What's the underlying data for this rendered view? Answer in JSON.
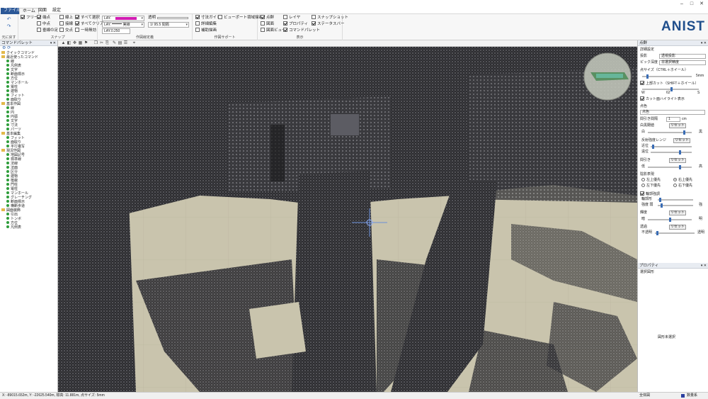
{
  "ribbon": {
    "tabs": [
      "ファイル",
      "ホーム",
      "図面",
      "設定"
    ],
    "undo_label": "元に戻す",
    "snap": {
      "label": "スナップ",
      "items": [
        {
          "label": "フリー",
          "checked": true
        },
        {
          "label": "端点",
          "checked": true
        },
        {
          "label": "中点",
          "checked": false
        },
        {
          "label": "垂線の足",
          "checked": false
        },
        {
          "label": "線上",
          "checked": false
        },
        {
          "label": "接線",
          "checked": false
        },
        {
          "label": "交点",
          "checked": false
        },
        {
          "label": "すべて選択",
          "checked": true
        },
        {
          "label": "すべてクリア",
          "checked": true
        },
        {
          "label": "一時無効",
          "checked": false
        }
      ]
    },
    "drawing_settings": {
      "label": "作図線定義",
      "layer1": "LAY.",
      "layer2": "LAY.",
      "layer2_style": "実線",
      "layer3": "LAY.0.250",
      "transparency_label": "透明",
      "scale_value": "1/ 95.5",
      "scale_suffix": "間隔"
    },
    "support": {
      "label": "作図サポート",
      "items": [
        {
          "label": "寸法ガイド",
          "checked": true
        },
        {
          "label": "ビューポート領域描画",
          "checked": false
        },
        {
          "label": "詳細編集",
          "checked": false
        },
        {
          "label": "補助描画",
          "checked": false
        }
      ]
    },
    "display": {
      "label": "表示",
      "items": [
        {
          "label": "点群",
          "checked": true
        },
        {
          "label": "図面",
          "checked": false
        },
        {
          "label": "図面ビュー",
          "checked": false
        },
        {
          "label": "レイヤ",
          "checked": false
        },
        {
          "label": "プロパティ",
          "checked": true
        },
        {
          "label": "コマンドパレット",
          "checked": true
        },
        {
          "label": "スナップショット",
          "checked": false
        },
        {
          "label": "ステータスバー",
          "checked": true
        }
      ]
    },
    "logo": "ANIST"
  },
  "command_palette": {
    "title": "コマンドパレット",
    "items": [
      {
        "label": "クイックコマンド",
        "type": "folder"
      },
      {
        "label": "最近使ったコマンド",
        "type": "folder"
      },
      {
        "label": "線",
        "type": "item"
      },
      {
        "label": "凡例表",
        "type": "item"
      },
      {
        "label": "文字",
        "type": "item"
      },
      {
        "label": "断面標示",
        "type": "item"
      },
      {
        "label": "方位",
        "type": "item"
      },
      {
        "label": "マンホール",
        "type": "item"
      },
      {
        "label": "電柱",
        "type": "item"
      },
      {
        "label": "建物",
        "type": "item"
      },
      {
        "label": "フィット",
        "type": "item"
      },
      {
        "label": "面取り",
        "type": "item"
      },
      {
        "label": "基本作図",
        "type": "folder"
      },
      {
        "label": "線",
        "type": "item"
      },
      {
        "label": "円",
        "type": "item"
      },
      {
        "label": "円弧",
        "type": "item"
      },
      {
        "label": "文字",
        "type": "item"
      },
      {
        "label": "寸法",
        "type": "item"
      },
      {
        "label": "パーツ",
        "type": "item"
      },
      {
        "label": "基本編集",
        "type": "folder"
      },
      {
        "label": "フィット",
        "type": "item"
      },
      {
        "label": "面取り",
        "type": "item"
      },
      {
        "label": "平行複写",
        "type": "item"
      },
      {
        "label": "現況作図",
        "type": "folder"
      },
      {
        "label": "地図記号",
        "type": "item"
      },
      {
        "label": "標準線",
        "type": "item"
      },
      {
        "label": "法線",
        "type": "item"
      },
      {
        "label": "法面",
        "type": "item"
      },
      {
        "label": "区分",
        "type": "item"
      },
      {
        "label": "建物",
        "type": "item"
      },
      {
        "label": "植栽",
        "type": "item"
      },
      {
        "label": "門柱",
        "type": "item"
      },
      {
        "label": "電柱",
        "type": "item"
      },
      {
        "label": "マンホール",
        "type": "item"
      },
      {
        "label": "グレーチング",
        "type": "item"
      },
      {
        "label": "断面標示",
        "type": "item"
      },
      {
        "label": "横断歩道",
        "type": "item"
      },
      {
        "label": "図面装飾",
        "type": "folder"
      },
      {
        "label": "引出",
        "type": "item"
      },
      {
        "label": "トンボ",
        "type": "item"
      },
      {
        "label": "方位",
        "type": "item"
      },
      {
        "label": "凡例表",
        "type": "item"
      }
    ]
  },
  "right_panel": {
    "title": "点群",
    "detail_label": "詳細設定",
    "projection_label": "投影",
    "projection_value": "透視投影",
    "pick_label": "ピック深度",
    "pick_value": "非選択精度",
    "point_size_label": "点サイズ（CTRL＋ホイール）",
    "point_size_value": "5mm",
    "upper_cut_label": "上部カット（SHIFT＋ホイール）",
    "cut_w": "W",
    "cut_value": "62",
    "cut_s": "S",
    "highlight_label": "カット面ハイライト表示",
    "color_label": "点色",
    "color_value": "点色",
    "point_spacing_label": "間引き間隔",
    "point_spacing_value": "1",
    "point_spacing_unit": "cm",
    "color_balance_label": "白黒閾値",
    "reset1": "リセット",
    "white_label": "白",
    "black_label": "黒",
    "reflect_label": "反射強度レンジ",
    "reset2": "リセット",
    "near_label": "近位",
    "far_label": "遠位",
    "thin_label": "間引き",
    "reset3": "リセット",
    "low_label": "低",
    "high_label": "高",
    "contour_label": "陰影表現",
    "r1": "左上優先",
    "r2": "右上優先",
    "r3": "左下優先",
    "r4": "右下優先",
    "rim_label": "輪郭強調",
    "rim1": "輪郭形",
    "rim2": "強度 弱",
    "rim3": "強",
    "brightness_label": "輝度",
    "reset4": "リセット",
    "dark_label": "暗",
    "bright_label": "明",
    "transparency_label": "透過",
    "reset5": "リセット",
    "opaque_label": "不透明",
    "trans_label": "透明",
    "properties_title": "プロパティ",
    "selected_label": "選択図形",
    "no_selection": "図形未選択"
  },
  "statusbar": {
    "coords": "X: -89015.652m, Y: -22625.540m, 標高: 11.881m, 点サイズ: 5mm",
    "mode": "全体図",
    "toggle_label": "数量系"
  }
}
